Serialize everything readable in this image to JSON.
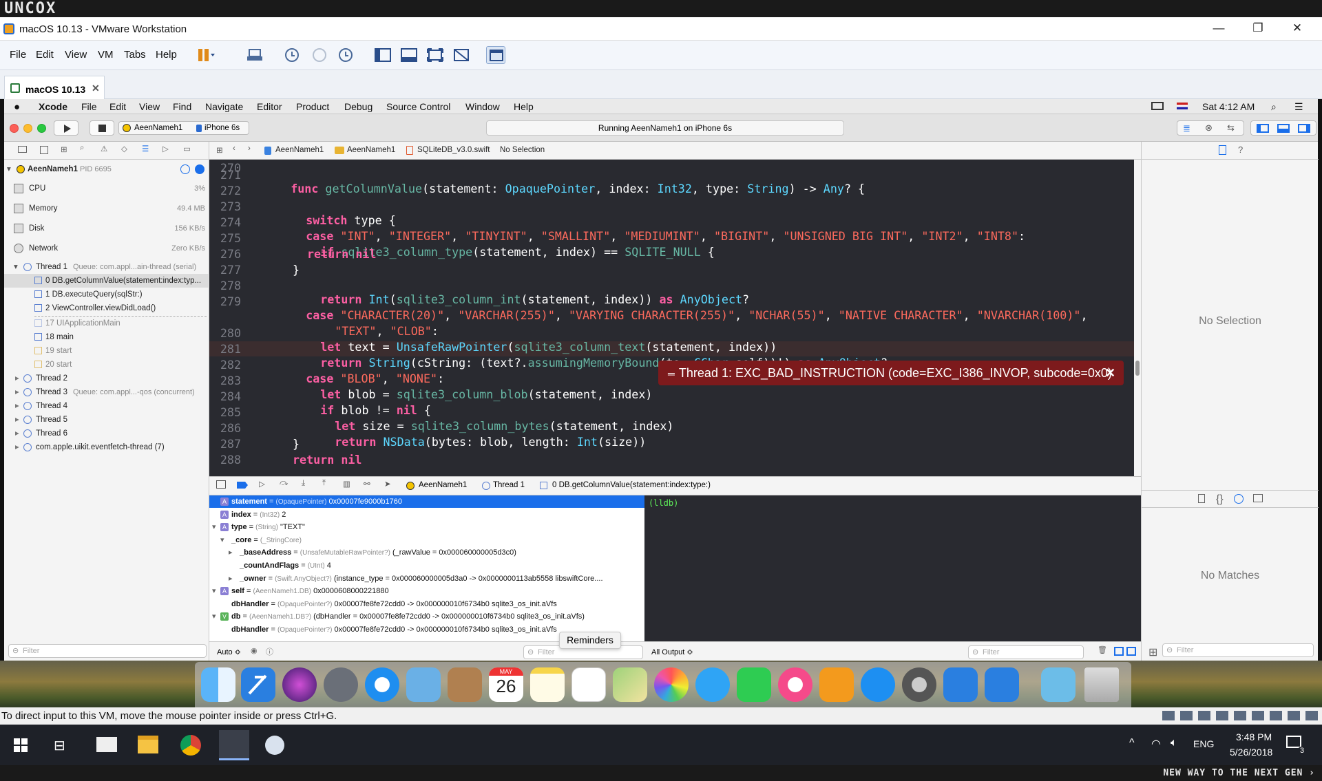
{
  "watermark": {
    "top": "UNCOX",
    "bottom": "NEW WAY TO THE NEXT GEN ›"
  },
  "vmware": {
    "title": "macOS 10.13 - VMware Workstation",
    "menu": [
      "File",
      "Edit",
      "View",
      "VM",
      "Tabs",
      "Help"
    ],
    "tab": "macOS 10.13",
    "status": "To direct input to this VM, move the mouse pointer inside or press Ctrl+G."
  },
  "mac_menu": {
    "app": "Xcode",
    "items": [
      "File",
      "Edit",
      "View",
      "Find",
      "Navigate",
      "Editor",
      "Product",
      "Debug",
      "Source Control",
      "Window",
      "Help"
    ],
    "clock": "Sat 4:12 AM"
  },
  "xcode_toolbar": {
    "scheme": "AeenNameh1",
    "device": "iPhone 6s",
    "activity": "Running AeenNameh1 on iPhone 6s"
  },
  "debug_nav": {
    "process": "AeenNameh1",
    "pid": "PID 6695",
    "gauges": [
      {
        "name": "CPU",
        "value": "3%"
      },
      {
        "name": "Memory",
        "value": "49.4 MB"
      },
      {
        "name": "Disk",
        "value": "156 KB/s"
      },
      {
        "name": "Network",
        "value": "Zero KB/s"
      }
    ],
    "thread1": {
      "label": "Thread 1",
      "queue": "Queue: com.appl...ain-thread (serial)"
    },
    "frames": [
      "0 DB.getColumnValue(statement:index:typ...",
      "1 DB.executeQuery(sqlStr:)",
      "2 ViewController.viewDidLoad()",
      "17 UIApplicationMain",
      "18 main",
      "19 start",
      "20 start"
    ],
    "threads": [
      {
        "label": "Thread 2",
        "queue": ""
      },
      {
        "label": "Thread 3",
        "queue": "Queue: com.appl...-qos (concurrent)"
      },
      {
        "label": "Thread 4",
        "queue": ""
      },
      {
        "label": "Thread 5",
        "queue": ""
      },
      {
        "label": "Thread 6",
        "queue": ""
      },
      {
        "label": "com.apple.uikit.eventfetch-thread (7)",
        "queue": ""
      }
    ],
    "filter_placeholder": "Filter"
  },
  "jump_bar": [
    "AeenNameh1",
    "AeenNameh1",
    "SQLiteDB_v3.0.swift",
    "No Selection"
  ],
  "editor": {
    "line_numbers": [
      "271",
      "272",
      "273",
      "274",
      "275",
      "276",
      "277",
      "278",
      "279",
      "",
      "280",
      "281",
      "282",
      "283",
      "284",
      "285",
      "286",
      "287",
      "288"
    ],
    "error": "Thread 1: EXC_BAD_INSTRUCTION (code=EXC_I386_INVOP, subcode=0x0)",
    "lines": {
      "l271": {
        "a": "func ",
        "b": "getColumnValue",
        "c": "(statement: ",
        "d": "OpaquePointer",
        "e": ", index: ",
        "f": "Int32",
        "g": ", type: ",
        "h": "String",
        "i": ") -> ",
        "j": "Any",
        "k": "? {"
      },
      "l273": {
        "a": "switch ",
        "b": "type {"
      },
      "l274": {
        "a": "case ",
        "b": "\"INT\"",
        "c": ", ",
        "d": "\"INTEGER\"",
        "e": ", ",
        "f": "\"TINYINT\"",
        "g": ", ",
        "h": "\"SMALLINT\"",
        "i": ", ",
        "j": "\"MEDIUMINT\"",
        "k": ", ",
        "l": "\"BIGINT\"",
        "m": ", ",
        "n": "\"UNSIGNED BIG INT\"",
        "o": ", ",
        "p": "\"INT2\"",
        "q": ", ",
        "r": "\"INT8\"",
        "s": ":"
      },
      "l275": {
        "a": "if ",
        "b": "sqlite3_column_type",
        "c": "(statement, index) == ",
        "d": "SQLITE_NULL",
        "e": " {"
      },
      "l276": {
        "a": "return nil"
      },
      "l277": {
        "a": "}"
      },
      "l278": {
        "a": "return ",
        "b": "Int",
        "c": "(",
        "d": "sqlite3_column_int",
        "e": "(statement, index)) ",
        "f": "as ",
        "g": "AnyObject",
        "h": "?"
      },
      "l279": {
        "a": "case ",
        "b": "\"CHARACTER(20)\"",
        "c": ", ",
        "d": "\"VARCHAR(255)\"",
        "e": ", ",
        "f": "\"VARYING CHARACTER(255)\"",
        "g": ", ",
        "h": "\"NCHAR(55)\"",
        "i": ", ",
        "j": "\"NATIVE CHARACTER\"",
        "k": ", ",
        "l": "\"NVARCHAR(100)\"",
        "m": ","
      },
      "l279b": {
        "a": "\"TEXT\"",
        "b": ", ",
        "c": "\"CLOB\"",
        "d": ":"
      },
      "l280": {
        "a": "let ",
        "b": "text = ",
        "c": "UnsafeRawPointer",
        "d": "(",
        "e": "sqlite3_column_text",
        "f": "(statement, index))"
      },
      "l281": {
        "a": "return ",
        "b": "String",
        "c": "(cString: (text?.",
        "d": "assumingMemoryBound",
        "e": "(to: ",
        "f": "CChar",
        "g": ".self))!) ",
        "h": "as ",
        "i": "AnyObject",
        "j": "?"
      },
      "l282": {
        "a": "case ",
        "b": "\"BLOB\"",
        "c": ", ",
        "d": "\"NONE\"",
        "e": ":"
      },
      "l283": {
        "a": "let ",
        "b": "blob = ",
        "c": "sqlite3_column_blob",
        "d": "(statement, index)"
      },
      "l284": {
        "a": "if ",
        "b": "blob != ",
        "c": "nil",
        "d": " {"
      },
      "l285": {
        "a": "let ",
        "b": "size = ",
        "c": "sqlite3_column_bytes",
        "d": "(statement, index)"
      },
      "l286": {
        "a": "return ",
        "b": "NSData",
        "c": "(bytes: blob, length: ",
        "d": "Int",
        "e": "(size))"
      },
      "l287": {
        "a": "}"
      },
      "l288": {
        "a": "return nil"
      }
    }
  },
  "debug_bar": {
    "crumbs": [
      "AeenNameh1",
      "Thread 1",
      "0 DB.getColumnValue(statement:index:type:)"
    ]
  },
  "variables": [
    {
      "badge": "A",
      "name": "statement",
      "type": "(OpaquePointer)",
      "value": "0x00007fe9000b1760"
    },
    {
      "badge": "A",
      "name": "index",
      "type": "(Int32)",
      "value": "2"
    },
    {
      "badge": "A",
      "name": "type",
      "type": "(String)",
      "value": "\"TEXT\""
    },
    {
      "badge": "",
      "name": "_core",
      "type": "(_StringCore)",
      "value": ""
    },
    {
      "badge": "",
      "name": "_baseAddress",
      "type": "(UnsafeMutableRawPointer?)",
      "value": "(_rawValue = 0x000060000005d3c0)"
    },
    {
      "badge": "",
      "name": "_countAndFlags",
      "type": "(UInt)",
      "value": "4"
    },
    {
      "badge": "",
      "name": "_owner",
      "type": "(Swift.AnyObject?)",
      "value": "(instance_type = 0x000060000005d3a0 -> 0x0000000113ab5558 libswiftCore...."
    },
    {
      "badge": "A",
      "name": "self",
      "type": "(AeenNameh1.DB)",
      "value": "0x0000608000221880"
    },
    {
      "badge": "",
      "name": "dbHandler",
      "type": "(OpaquePointer?)",
      "value": "0x00007fe8fe72cdd0 -> 0x000000010f6734b0 sqlite3_os_init.aVfs"
    },
    {
      "badge": "V",
      "name": "db",
      "type": "(AeenNameh1.DB?)",
      "value": "(dbHandler = 0x00007fe8fe72cdd0 -> 0x000000010f6734b0 sqlite3_os_init.aVfs)"
    },
    {
      "badge": "",
      "name": "dbHandler",
      "type": "(OpaquePointer?)",
      "value": "0x00007fe8fe72cdd0 -> 0x000000010f6734b0 sqlite3_os_init.aVfs"
    }
  ],
  "console": {
    "prompt": "(lldb)"
  },
  "footer": {
    "auto": "Auto ≎",
    "filter": "Filter",
    "output": "All Output ≎",
    "tooltip": "Reminders"
  },
  "inspector": {
    "no_selection": "No Selection",
    "no_matches": "No Matches",
    "filter": "Filter"
  },
  "dock": {
    "calendar_month": "MAY",
    "calendar_day": "26"
  },
  "taskbar": {
    "time": "3:48 PM",
    "date": "5/26/2018",
    "lang": "ENG",
    "notif": "3"
  },
  "colors": {
    "editor_bg": "#292a30",
    "keyword": "#fc5fa3",
    "string": "#fc6a5d",
    "type": "#5dd8ff",
    "function": "#67b7a4",
    "error": "#8b1c1c",
    "accent": "#1a6eea"
  }
}
